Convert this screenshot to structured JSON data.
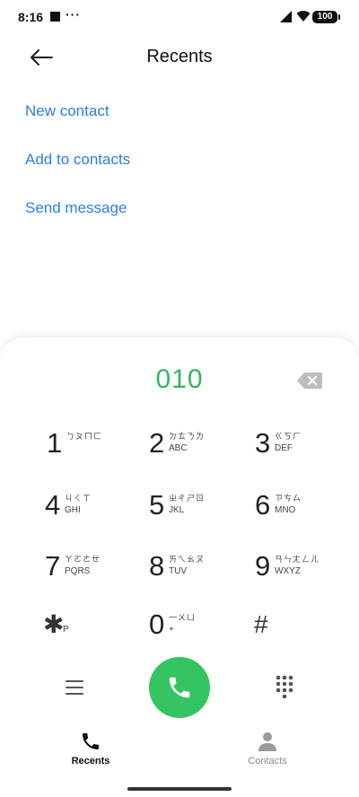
{
  "status_bar": {
    "time": "8:16",
    "dots": "···",
    "battery": "100"
  },
  "header": {
    "title": "Recents"
  },
  "menu": {
    "items": [
      {
        "label": "New contact"
      },
      {
        "label": "Add to contacts"
      },
      {
        "label": "Send message"
      }
    ]
  },
  "dialpad": {
    "number": "010",
    "keys": [
      {
        "digit": "1",
        "bpmf": "ㄅㄆㄇㄈ",
        "letters": ""
      },
      {
        "digit": "2",
        "bpmf": "ㄉㄊㄋㄌ",
        "letters": "ABC"
      },
      {
        "digit": "3",
        "bpmf": "ㄍㄎㄏ",
        "letters": "DEF"
      },
      {
        "digit": "4",
        "bpmf": "ㄐㄑㄒ",
        "letters": "GHI"
      },
      {
        "digit": "5",
        "bpmf": "ㄓㄔㄕㄖ",
        "letters": "JKL"
      },
      {
        "digit": "6",
        "bpmf": "ㄗㄘㄙ",
        "letters": "MNO"
      },
      {
        "digit": "7",
        "bpmf": "ㄚㄛㄜㄝ",
        "letters": "PQRS"
      },
      {
        "digit": "8",
        "bpmf": "ㄞㄟㄠㄡ",
        "letters": "TUV"
      },
      {
        "digit": "9",
        "bpmf": "ㄢㄣㄤㄥㄦ",
        "letters": "WXYZ"
      },
      {
        "symbol": "✱",
        "sub": "P"
      },
      {
        "digit": "0",
        "bpmf": "一ㄨㄩ",
        "letters": "+"
      },
      {
        "symbol": "#"
      }
    ]
  },
  "nav": {
    "tabs": [
      {
        "label": "Recents",
        "icon": "phone-icon",
        "active": true
      },
      {
        "label": "Contacts",
        "icon": "person-icon",
        "active": false
      }
    ]
  },
  "colors": {
    "accent": "#2d7ee6",
    "call_green": "#35c462",
    "number_green": "#2fb862"
  }
}
